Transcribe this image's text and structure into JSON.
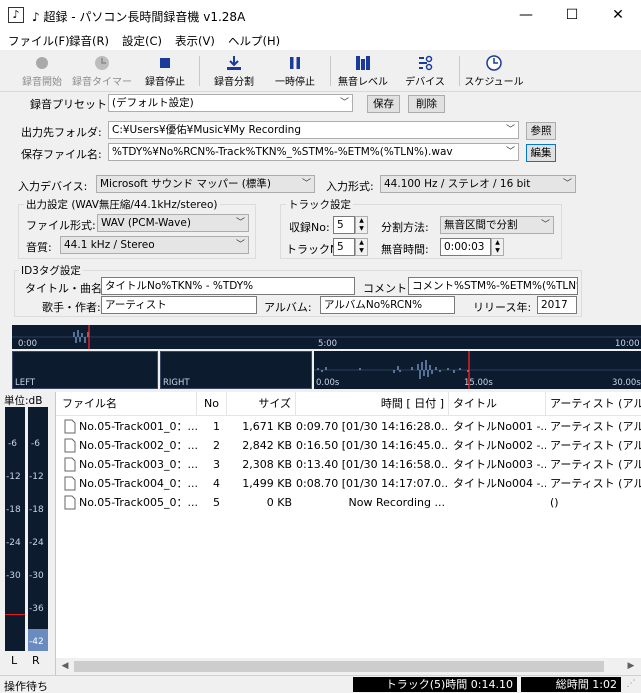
{
  "window": {
    "title": "♪ 超録 - パソコン長時間録音機 v1.28A",
    "minimize": "—",
    "maximize": "☐",
    "close": "✕"
  },
  "menu": [
    "ファイル(F)",
    "録音(R)",
    "設定(C)",
    "表示(V)",
    "ヘルプ(H)"
  ],
  "toolbar": {
    "record_start": "録音開始",
    "record_timer": "録音タイマー",
    "record_stop": "録音停止",
    "record_split": "録音分割",
    "pause": "一時停止",
    "silence_level": "無音レベル",
    "device": "デバイス",
    "schedule": "スケジュール"
  },
  "preset": {
    "label": "録音プリセット:",
    "value": "(デフォルト設定)",
    "save": "保存",
    "delete": "削除"
  },
  "output": {
    "folder_label": "出力先フォルダ:",
    "folder_value": "C:¥Users¥優佑¥Music¥My Recording",
    "browse": "参照",
    "filename_label": "保存ファイル名:",
    "filename_value": "%TDY%¥No%RCN%-Track%TKN%_%STM%-%ETM%(%TLN%).wav",
    "edit": "編集"
  },
  "input": {
    "device_label": "入力デバイス:",
    "device_value": "Microsoft サウンド マッパー (標準)",
    "format_label": "入力形式:",
    "format_value": "44.100 Hz / ステレオ / 16 bit"
  },
  "output_settings": {
    "title": "出力設定 (WAV無圧縮/44.1kHz/stereo)",
    "filetype_label": "ファイル形式:",
    "filetype_value": "WAV (PCM-Wave)",
    "quality_label": "音質:",
    "quality_value": "44.1 kHz / Stereo"
  },
  "track_settings": {
    "title": "トラック設定",
    "record_no_label": "収録No:",
    "record_no_value": "5",
    "track_no_label": "トラックNo:",
    "track_no_value": "5",
    "split_label": "分割方法:",
    "split_value": "無音区間で分割",
    "silence_time_label": "無音時間:",
    "silence_time_value": "0:00:03"
  },
  "id3": {
    "title": "ID3タグ設定",
    "title_label": "タイトル・曲名:",
    "title_value": "タイトルNo%TKN% - %TDY%",
    "comment_label": "コメント:",
    "comment_value": "コメント%STM%-%ETM%(%TLN%)",
    "artist_label": "歌手・作者:",
    "artist_value": "アーティスト",
    "album_label": "アルバム:",
    "album_value": "アルバムNo%RCN%",
    "year_label": "リリース年:",
    "year_value": "2017"
  },
  "waveform": {
    "time_start": "0:00",
    "time_mid": "5:00",
    "time_end": "10:00",
    "left_label": "LEFT",
    "right_label": "RIGHT",
    "zoom_start": "0.00s",
    "zoom_mid": "15.00s",
    "zoom_end": "30.00s"
  },
  "meter": {
    "unit_label": "単位:dB",
    "scale": [
      "-6",
      "-12",
      "-18",
      "-24",
      "-30",
      "-36",
      "-42"
    ],
    "left": "L",
    "right": "R"
  },
  "file_list": {
    "headers": [
      "ファイル名",
      "No",
      "サイズ",
      "時間 [ 日付 ]",
      "タイトル",
      "アーティスト (アルバム)"
    ],
    "rows": [
      {
        "name": "No.05-Track001_0：...",
        "no": "1",
        "size": "1,671 KB",
        "time": "0:09.70 [01/30 14:16:28.0...",
        "title": "タイトルNo001 -...",
        "artist": "アーティスト (アルバム"
      },
      {
        "name": "No.05-Track002_0：...",
        "no": "2",
        "size": "2,842 KB",
        "time": "0:16.50 [01/30 14:16:45.0...",
        "title": "タイトルNo002 -...",
        "artist": "アーティスト (アルバム"
      },
      {
        "name": "No.05-Track003_0：...",
        "no": "3",
        "size": "2,308 KB",
        "time": "0:13.40 [01/30 14:16:58.0...",
        "title": "タイトルNo003 -...",
        "artist": "アーティスト (アルバム"
      },
      {
        "name": "No.05-Track004_0：...",
        "no": "4",
        "size": "1,499 KB",
        "time": "0:08.70 [01/30 14:17:07.0...",
        "title": "タイトルNo004 -...",
        "artist": "アーティスト (アルバム"
      },
      {
        "name": "No.05-Track005_0：...",
        "no": "5",
        "size": "0 KB",
        "time": "Now Recording ...",
        "title": "",
        "artist": "()"
      }
    ]
  },
  "status": {
    "left": "操作待ち",
    "track_time": "トラック(5)時間 0:14.10",
    "total_time": "総時間 1:02"
  }
}
